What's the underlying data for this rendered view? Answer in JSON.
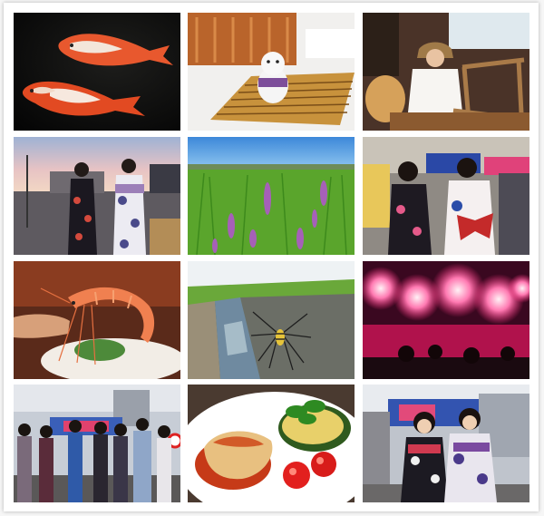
{
  "collage": {
    "tiles": [
      {
        "name": "koi-fish-photo"
      },
      {
        "name": "decor-figurine-photo"
      },
      {
        "name": "loom-weaving-photo"
      },
      {
        "name": "yukata-street-photo"
      },
      {
        "name": "rice-field-flowers-photo"
      },
      {
        "name": "festival-girls-photo"
      },
      {
        "name": "shrimp-photo"
      },
      {
        "name": "canal-spider-photo"
      },
      {
        "name": "fireworks-photo"
      },
      {
        "name": "festival-group-photo"
      },
      {
        "name": "dinner-plate-photo"
      },
      {
        "name": "yukata-duo-photo"
      }
    ]
  }
}
